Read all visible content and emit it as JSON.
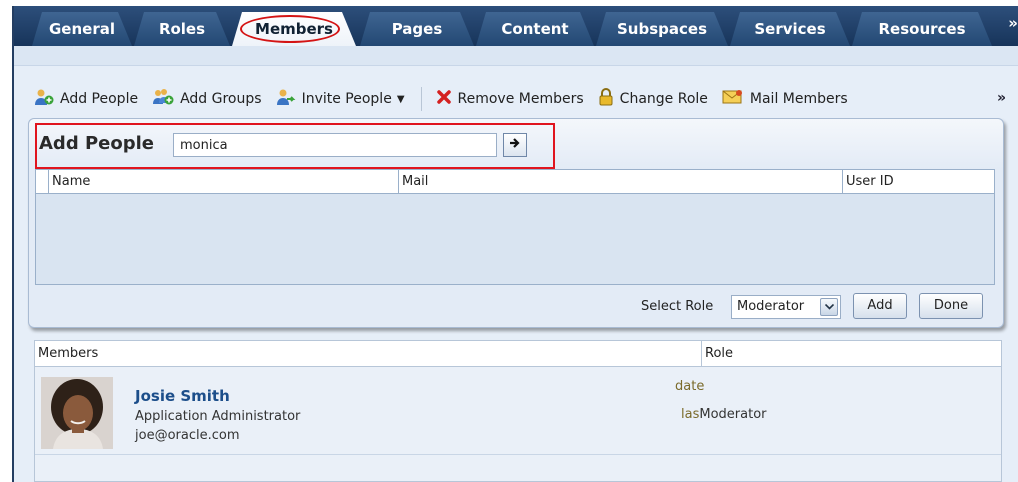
{
  "tabs": [
    {
      "label": "General"
    },
    {
      "label": "Roles"
    },
    {
      "label": "Members"
    },
    {
      "label": "Pages"
    },
    {
      "label": "Content"
    },
    {
      "label": "Subspaces"
    },
    {
      "label": "Services"
    },
    {
      "label": "Resources"
    }
  ],
  "tabs_overflow": "»",
  "toolbar": {
    "add_people": "Add People",
    "add_groups": "Add Groups",
    "invite_people": "Invite People",
    "remove_members": "Remove Members",
    "change_role": "Change Role",
    "mail_members": "Mail Members",
    "overflow": "»"
  },
  "add_people": {
    "title": "Add People",
    "search_value": "monica",
    "columns": [
      "Name",
      "Mail",
      "User ID"
    ],
    "select_role_label": "Select Role",
    "selected_role": "Moderator",
    "add_button": "Add",
    "done_button": "Done"
  },
  "members": {
    "columns": [
      "Members",
      "Role"
    ],
    "rows": [
      {
        "name": "Josie Smith",
        "title": "Application Administrator",
        "email": "joe@oracle.com",
        "date_label": "date",
        "last_label": "las",
        "role": "Moderator"
      }
    ]
  },
  "colors": {
    "tabbar": "#17345a",
    "accent": "#1c4e8a",
    "highlight": "#e0141e"
  }
}
